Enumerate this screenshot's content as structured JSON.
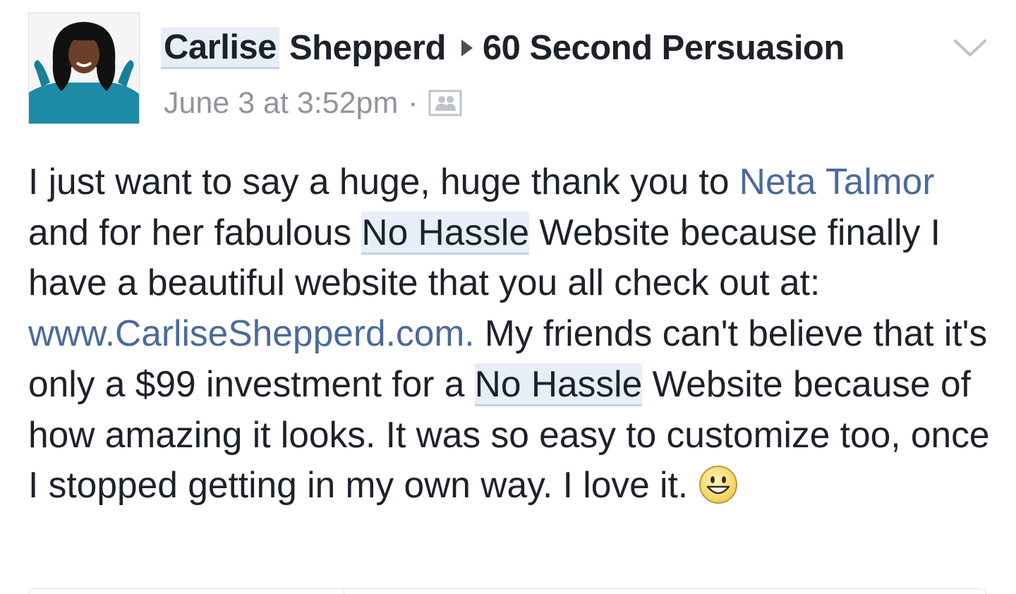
{
  "post": {
    "author_first": "Carlise",
    "author_last": "Shepperd",
    "group_name": "60 Second Persuasion",
    "timestamp": "June 3 at 3:52pm",
    "meta_separator": "·",
    "audience_icon": "group-members-icon",
    "menu_icon": "chevron-down-icon",
    "body": {
      "t1": "I just want to say a huge, huge thank you to ",
      "mention": "Neta Talmor",
      "t2": " and for her fabulous ",
      "highlight1": "No Hassle",
      "t3": " Website because finally I have a beautiful website that you all check out at: ",
      "url": "www.CarliseShepperd.com.",
      "t4": " My friends can't believe that it's only a $99 investment for a ",
      "highlight2": "No Hassle",
      "t5": " Website because of how amazing it looks. It was so easy to customize too, once I stopped getting in my own way. I love it.",
      "emoji": "grinning-face-icon"
    }
  },
  "colors": {
    "text": "#1d2129",
    "link": "#4b6a9b",
    "meta": "#90949c",
    "highlight_bg": "#e8eef8",
    "highlight_border": "#c3d0e8"
  }
}
